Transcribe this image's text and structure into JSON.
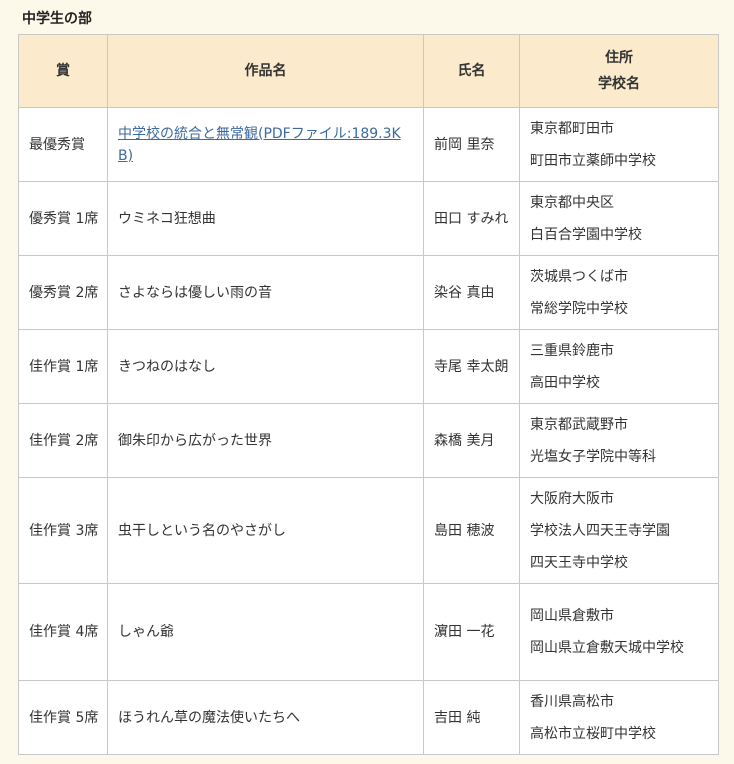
{
  "section": {
    "title": "中学生の部"
  },
  "table": {
    "headers": {
      "award": "賞",
      "title": "作品名",
      "name": "氏名",
      "address": "住所",
      "school": "学校名"
    },
    "rows": [
      {
        "award": "最優秀賞",
        "title": "中学校の統合と無常観(PDFファイル:189.3KB)",
        "is_link": true,
        "name": "前岡 里奈",
        "place": [
          "東京都町田市",
          "町田市立薬師中学校"
        ]
      },
      {
        "award": "優秀賞 1席",
        "title": "ウミネコ狂想曲",
        "is_link": false,
        "name": "田口 すみれ",
        "place": [
          "東京都中央区",
          "白百合学園中学校"
        ]
      },
      {
        "award": "優秀賞 2席",
        "title": "さよならは優しい雨の音",
        "is_link": false,
        "name": "染谷 真由",
        "place": [
          "茨城県つくば市",
          "常総学院中学校"
        ]
      },
      {
        "award": "佳作賞 1席",
        "title": "きつねのはなし",
        "is_link": false,
        "name": "寺尾 幸太朗",
        "place": [
          " 三重県鈴鹿市",
          "高田中学校"
        ]
      },
      {
        "award": "佳作賞 2席",
        "title": "御朱印から広がった世界",
        "is_link": false,
        "name": "森橋 美月",
        "place": [
          "東京都武蔵野市",
          "光塩女子学院中等科"
        ]
      },
      {
        "award": "佳作賞 3席",
        "title": "虫干しという名のやさがし",
        "is_link": false,
        "name": "島田 穂波",
        "place": [
          "大阪府大阪市",
          "学校法人四天王寺学園",
          "四天王寺中学校"
        ]
      },
      {
        "award": "佳作賞 4席",
        "title": "しゃん爺",
        "is_link": false,
        "name": "濵田 一花",
        "place": [
          "岡山県倉敷市",
          "岡山県立倉敷天城中学校"
        ]
      },
      {
        "award": "佳作賞 5席",
        "title": "ほうれん草の魔法使いたちへ",
        "is_link": false,
        "name": "吉田 純",
        "place": [
          "香川県高松市",
          "高松市立桜町中学校"
        ]
      }
    ]
  }
}
